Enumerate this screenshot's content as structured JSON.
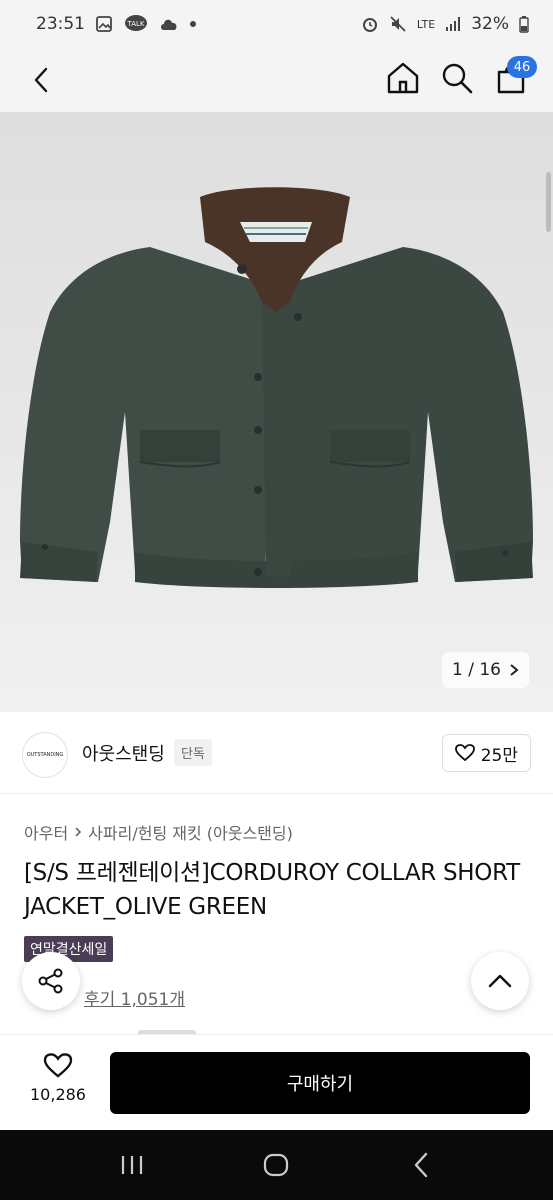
{
  "status_bar": {
    "time": "23:51",
    "talk_label": "TALK",
    "network": "LTE",
    "battery": "32%"
  },
  "header": {
    "cart_count": "46"
  },
  "gallery": {
    "counter": "1 / 16"
  },
  "brand": {
    "logo_text": "OUTSTANDING",
    "name": "아웃스탠딩",
    "tag": "단독",
    "likes": "25만"
  },
  "breadcrumb": {
    "level1": "아우터",
    "level2": "사파리/헌팅 재킷 (아웃스탠딩)"
  },
  "product": {
    "title": "[S/S 프레젠테이션]CORDUROY COLLAR SHORT JACKET_OLIVE GREEN",
    "sale_tag": "연말결산세일",
    "reviews": "후기 1,051개"
  },
  "purchase_bar": {
    "wish_count": "10,286",
    "buy_label": "구매하기"
  },
  "colors": {
    "accent": "#2b72e5",
    "buy_button": "#000000",
    "sale_tag": "#4a3d55",
    "jacket": "#3f4d46",
    "collar": "#4a3428"
  }
}
